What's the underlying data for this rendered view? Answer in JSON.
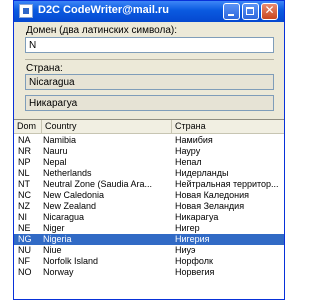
{
  "window": {
    "title": "D2C CodeWriter@mail.ru"
  },
  "domain_field": {
    "label": "Домен (два латинских символа):",
    "value": "N"
  },
  "country_field": {
    "label": "Страна:",
    "value_en": "Nicaragua",
    "value_ru": "Никарагуа"
  },
  "list": {
    "columns": [
      "Dom",
      "Country",
      "Страна"
    ],
    "selected_index": 9,
    "rows": [
      {
        "dom": "NA",
        "country": "Namibia",
        "strana": "Намибия"
      },
      {
        "dom": "NR",
        "country": "Nauru",
        "strana": "Науру"
      },
      {
        "dom": "NP",
        "country": "Nepal",
        "strana": "Непал"
      },
      {
        "dom": "NL",
        "country": "Netherlands",
        "strana": "Нидерланды"
      },
      {
        "dom": "NT",
        "country": "Neutral Zone (Saudia Ara...",
        "strana": "Нейтральная территор..."
      },
      {
        "dom": "NC",
        "country": "New Caledonia",
        "strana": "Новая Каледония"
      },
      {
        "dom": "NZ",
        "country": "New Zealand",
        "strana": "Новая Зеландия"
      },
      {
        "dom": "NI",
        "country": "Nicaragua",
        "strana": "Никарагуа"
      },
      {
        "dom": "NE",
        "country": "Niger",
        "strana": "Нигер"
      },
      {
        "dom": "NG",
        "country": "Nigeria",
        "strana": "Нигерия"
      },
      {
        "dom": "NU",
        "country": "Niue",
        "strana": "Ниуэ"
      },
      {
        "dom": "NF",
        "country": "Norfolk Island",
        "strana": "Норфолк"
      },
      {
        "dom": "NO",
        "country": "Norway",
        "strana": "Норвегия"
      }
    ]
  }
}
